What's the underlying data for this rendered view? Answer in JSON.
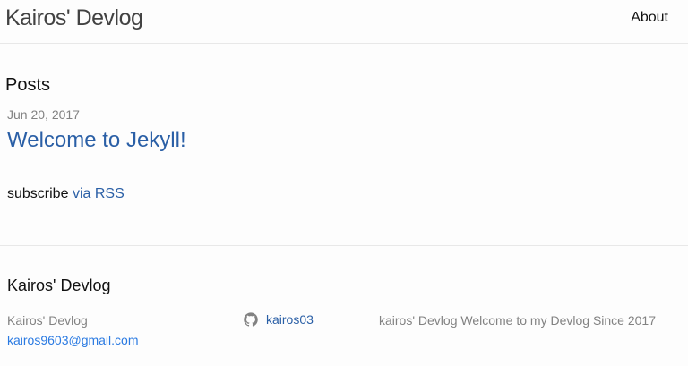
{
  "header": {
    "site_title": "Kairos' Devlog",
    "nav": [
      {
        "label": "About"
      }
    ]
  },
  "main": {
    "posts_heading": "Posts",
    "posts": [
      {
        "date": "Jun 20, 2017",
        "title": "Welcome to Jekyll!"
      }
    ],
    "rss": {
      "prefix": "subscribe",
      "link_label": "via RSS"
    }
  },
  "footer": {
    "heading": "Kairos' Devlog",
    "name": "Kairos' Devlog",
    "email": "kairos9603@gmail.com",
    "github_icon": "github-icon",
    "github_username": "kairos03",
    "description": "kairos' Devlog Welcome to my Devlog Since 2017"
  },
  "colors": {
    "link": "#2a5fa6",
    "meta": "#828282",
    "border": "#e8e8e8",
    "background": "#fdfdfd"
  }
}
